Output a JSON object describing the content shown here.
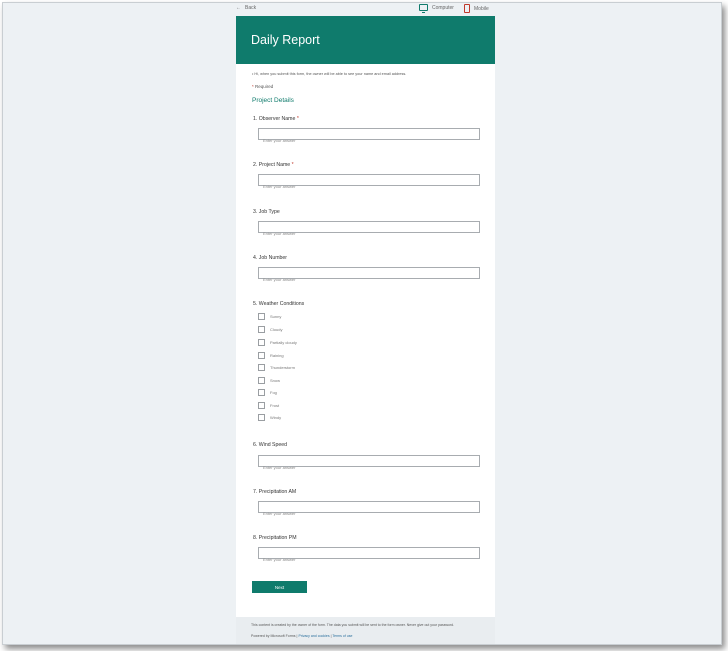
{
  "topbar": {
    "back_label": "Back",
    "computer_label": "Computer",
    "mobile_label": "Mobile"
  },
  "colors": {
    "theme": "#0f7b6c",
    "required_star": "#c0392b",
    "background": "#edf1f4"
  },
  "form": {
    "title": "Daily Report",
    "notice": "Hi, when you submit this form, the owner will be able to see your name and email address.",
    "required_label": "Required",
    "section": "Project Details",
    "placeholder": "Enter your answer",
    "questions": [
      {
        "label": "1. Observer Name",
        "required": "*"
      },
      {
        "label": "2. Project Name",
        "required": "*"
      },
      {
        "label": "3. Job Type"
      },
      {
        "label": "4. Job Number"
      },
      {
        "label": "5. Weather Conditions"
      },
      {
        "label": "6. Wind Speed"
      },
      {
        "label": "7. Precipitation AM"
      },
      {
        "label": "8. Precipitation PM"
      }
    ],
    "weather_options": [
      "Sunny",
      "Cloudy",
      "Partially cloudy",
      "Raining",
      "Thunderstorm",
      "Snow",
      "Fog",
      "Frost",
      "Windy"
    ],
    "next_label": "Next"
  },
  "footer": {
    "line1": "This content is created by the owner of the form. The data you submit will be sent to the form owner. Never give out your password.",
    "powered": "Powered by Microsoft Forms",
    "privacy": "Privacy and cookies",
    "terms": "Terms of use",
    "sep": "|"
  }
}
